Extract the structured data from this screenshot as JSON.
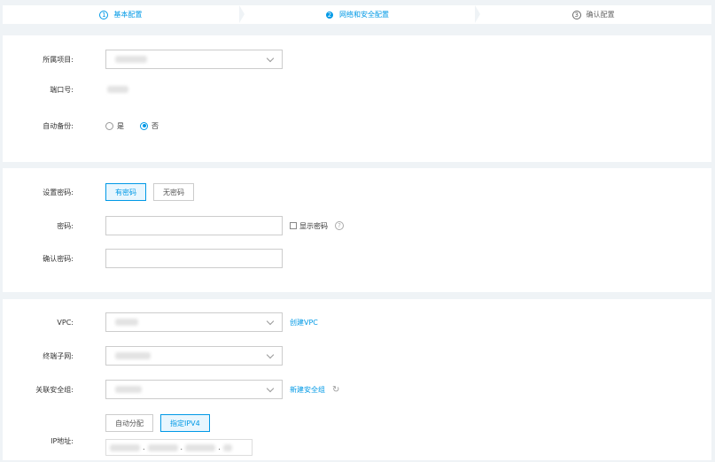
{
  "steps": [
    {
      "num": "1",
      "label": "基本配置",
      "state": "done"
    },
    {
      "num": "2",
      "label": "网络和安全配置",
      "state": "active"
    },
    {
      "num": "3",
      "label": "确认配置",
      "state": "pending"
    }
  ],
  "basic": {
    "project_label": "所属项目:",
    "port_label": "端口号:",
    "backup_label": "自动备份:",
    "backup_yes": "是",
    "backup_no": "否",
    "backup_selected": "否"
  },
  "password": {
    "set_label": "设置密码:",
    "with_pwd": "有密码",
    "no_pwd": "无密码",
    "selected": "有密码",
    "pwd_label": "密码:",
    "show_pwd": "显示密码",
    "help": "?",
    "confirm_label": "确认密码:"
  },
  "network": {
    "vpc_label": "VPC:",
    "create_vpc": "创建VPC",
    "subnet_label": "终端子网:",
    "sg_label": "关联安全组:",
    "create_sg": "新建安全组",
    "ip_label": "IP地址:",
    "ip_auto": "自动分配",
    "ip_manual": "指定IPV4",
    "ip_selected": "指定IPV4",
    "ip_dots": "."
  },
  "colors": {
    "accent": "#0099e6",
    "bg": "#eff3f6"
  }
}
